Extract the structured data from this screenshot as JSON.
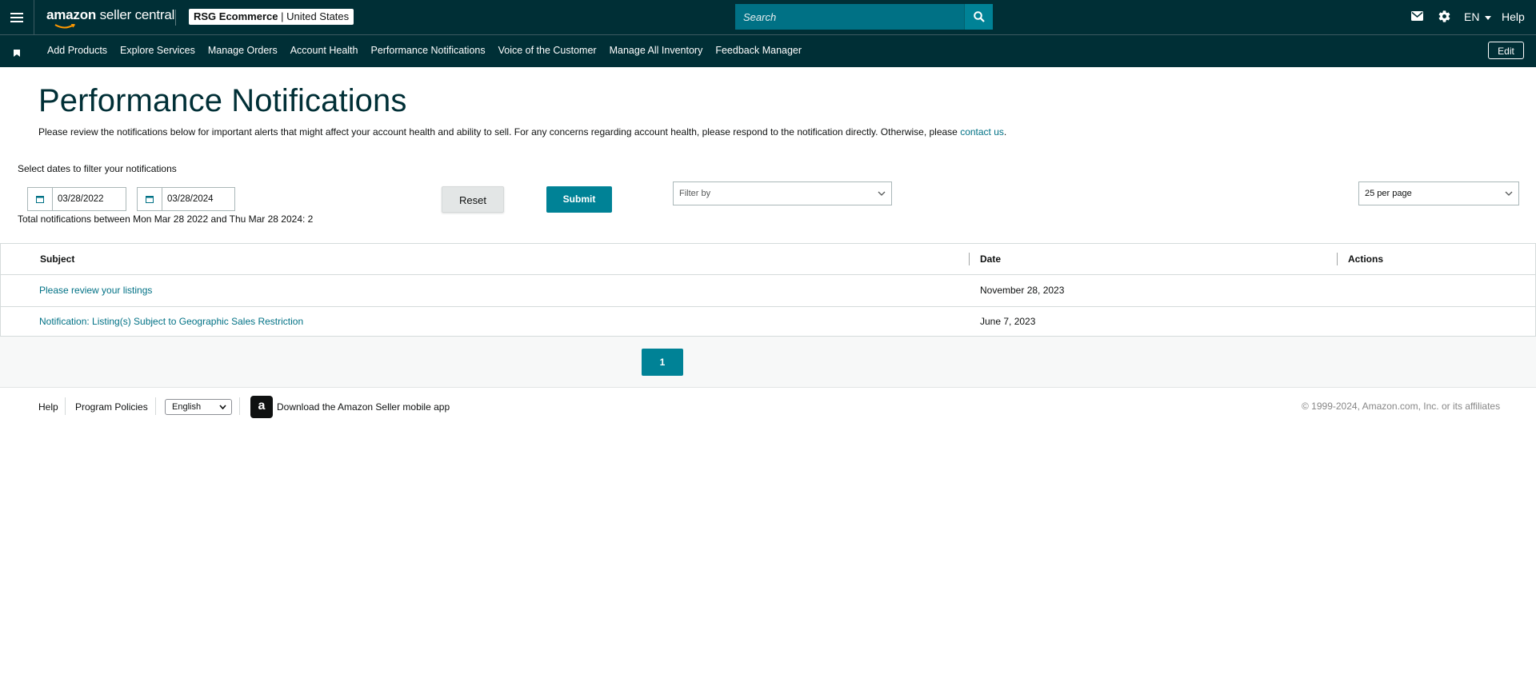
{
  "header": {
    "logo_part1": "amazon",
    "logo_part2": " seller central",
    "account_name": "RSG Ecommerce",
    "account_region": "United States",
    "search_placeholder": "Search",
    "language": "EN",
    "help": "Help"
  },
  "nav": {
    "links": [
      "Add Products",
      "Explore Services",
      "Manage Orders",
      "Account Health",
      "Performance Notifications",
      "Voice of the Customer",
      "Manage All Inventory",
      "Feedback Manager"
    ],
    "edit": "Edit"
  },
  "page": {
    "title": "Performance Notifications",
    "description": "Please review the notifications below for important alerts that might affect your account health and ability to sell. For any concerns regarding account health, please respond to the notification directly. Otherwise, please ",
    "contact_link": "contact us",
    "description_end": "."
  },
  "filters": {
    "select_label": "Select dates to filter your notifications",
    "start_date": "03/28/2022",
    "end_date": "03/28/2024",
    "reset": "Reset",
    "submit": "Submit",
    "filter_placeholder": "Filter by",
    "per_page": "25 per page",
    "total": "Total notifications between Mon Mar 28 2022 and Thu Mar 28 2024: 2"
  },
  "table": {
    "columns": [
      "Subject",
      "Date",
      "Actions"
    ],
    "rows": [
      {
        "subject": "Please review your listings",
        "date": "November 28, 2023"
      },
      {
        "subject": "Notification: Listing(s) Subject to Geographic Sales Restriction",
        "date": "June 7, 2023"
      }
    ]
  },
  "pagination": {
    "current_page": "1"
  },
  "footer": {
    "help": "Help",
    "program_policies": "Program Policies",
    "language": "English",
    "app_text": "Download the Amazon Seller mobile app",
    "copyright": "© 1999-2024, Amazon.com, Inc. or its affiliates"
  },
  "colors": {
    "header_bg": "#002f36",
    "accent": "#008296",
    "link": "#007185"
  }
}
